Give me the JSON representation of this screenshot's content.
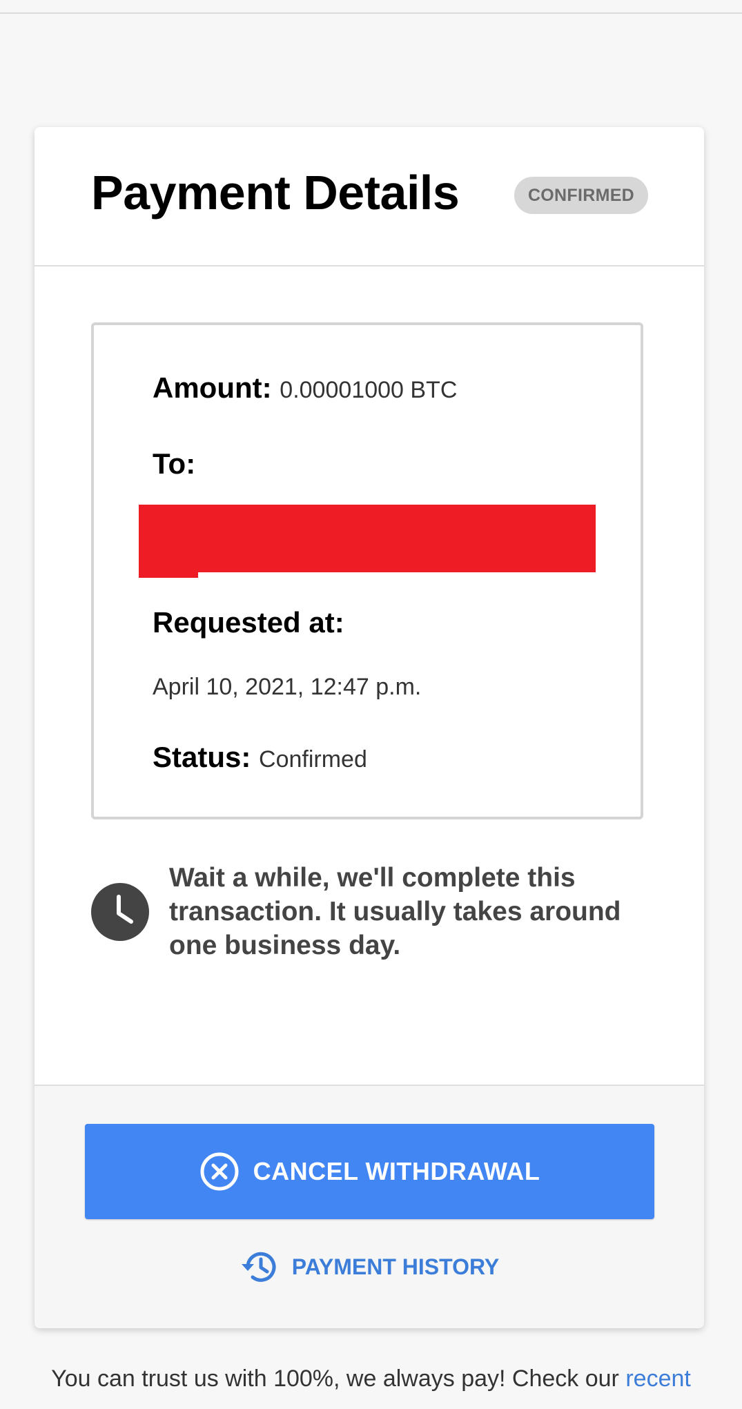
{
  "header": {
    "title": "Payment Details",
    "badge": "CONFIRMED"
  },
  "details": {
    "amount_label": "Amount:",
    "amount_value": "0.00001000 BTC",
    "to_label": "To:",
    "requested_label": "Requested at:",
    "requested_value": "April 10, 2021, 12:47 p.m.",
    "status_label": "Status:",
    "status_value": "Confirmed"
  },
  "notice": {
    "icon": "clock-icon",
    "text": "Wait a while, we'll complete this transaction. It usually takes around one business day."
  },
  "actions": {
    "cancel_label": "CANCEL WITHDRAWAL",
    "cancel_icon": "circle-x-icon",
    "history_label": "PAYMENT HISTORY",
    "history_icon": "history-icon"
  },
  "footer": {
    "trust_text": "You can trust us with 100%, we always pay! Check our",
    "trust_link": "recent"
  },
  "colors": {
    "primary": "#4286f4",
    "link": "#3b7dd8",
    "redaction": "#ee1c25",
    "badge_bg": "#d7d7d7"
  }
}
